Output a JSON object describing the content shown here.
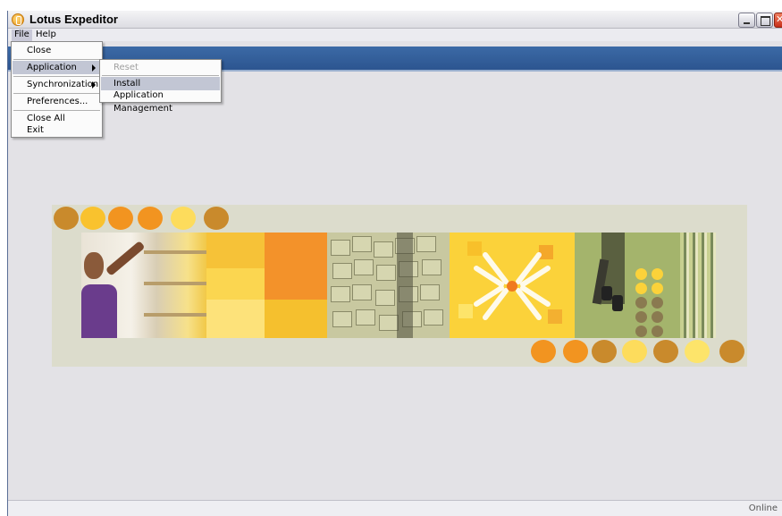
{
  "window": {
    "title": "Lotus Expeditor",
    "controls": [
      "minimize",
      "maximize",
      "close"
    ]
  },
  "menubar": {
    "items": [
      "File",
      "Help"
    ]
  },
  "file_menu": {
    "items": [
      {
        "label": "Close"
      },
      {
        "label": "Application",
        "submenu": true,
        "selected": true
      },
      {
        "label": "Synchronization",
        "submenu": true
      },
      {
        "label": "Preferences..."
      },
      {
        "label": "Close All"
      },
      {
        "label": "Exit"
      }
    ]
  },
  "application_submenu": {
    "items": [
      {
        "label": "Reset",
        "disabled": true
      },
      {
        "label": "Install",
        "selected": true
      },
      {
        "label": "Application Management"
      }
    ]
  },
  "status_bar": {
    "text": "Online"
  },
  "colors": {
    "band": "#2c5590",
    "orange": "#f29420",
    "gold": "#c98a2c",
    "yellow": "#fddc5c"
  }
}
